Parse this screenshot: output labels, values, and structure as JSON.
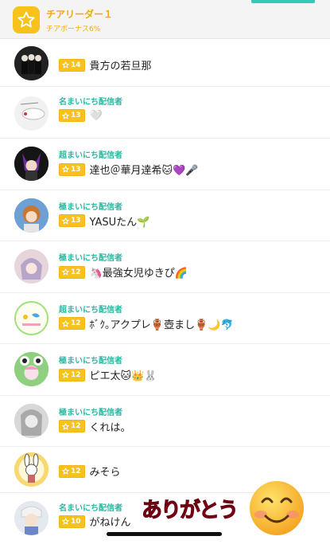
{
  "header": {
    "title": "チアリーダー１",
    "subtitle": "チアボーナス6%"
  },
  "rows": [
    {
      "rank_title": "",
      "level": "14",
      "name": "貴方の若旦那"
    },
    {
      "rank_title": "名まいにち配信者",
      "level": "13",
      "name": "🤍"
    },
    {
      "rank_title": "超まいにち配信者",
      "level": "13",
      "name": "達也＠華月達希🐱💜🎤"
    },
    {
      "rank_title": "極まいにち配信者",
      "level": "13",
      "name": "YASUたん🌱"
    },
    {
      "rank_title": "極まいにち配信者",
      "level": "12",
      "name": "🦄最強女児ゆきぴ🌈"
    },
    {
      "rank_title": "超まいにち配信者",
      "level": "12",
      "name": "ﾎﾞｸ｡アクプレ🏺壺まし🏺🌙🐬"
    },
    {
      "rank_title": "極まいにち配信者",
      "level": "12",
      "name": "ピエ太🐱👑🐰"
    },
    {
      "rank_title": "極まいにち配信者",
      "level": "12",
      "name": "くれは。"
    },
    {
      "rank_title": "",
      "level": "12",
      "name": "みそら"
    },
    {
      "rank_title": "名まいにち配信者",
      "level": "10",
      "name": "がねけん"
    }
  ],
  "sticker": {
    "text": "ありがとう"
  },
  "icons": {
    "level_badge": "star-icon",
    "header_badge": "star-icon",
    "sticker": "smiley-icon"
  },
  "colors": {
    "accent": "#f7c21b",
    "rank_title": "#2cb8a3",
    "tab_indicator": "#36c8b4"
  }
}
